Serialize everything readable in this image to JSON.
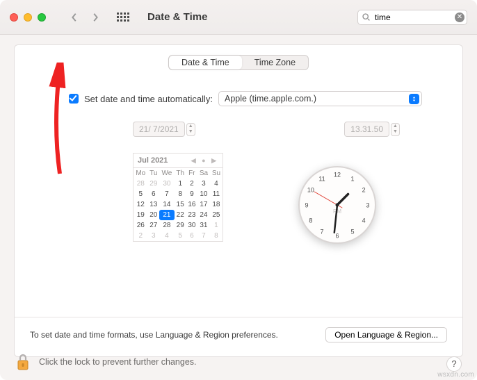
{
  "titlebar": {
    "title": "Date & Time",
    "search_value": "time"
  },
  "tabs": {
    "active": "Date & Time",
    "inactive": "Time Zone"
  },
  "auto": {
    "label": "Set date and time automatically:",
    "server": "Apple (time.apple.com.)"
  },
  "date_field": "21/ 7/2021",
  "time_field": "13.31.50",
  "calendar": {
    "month": "Jul 2021",
    "dow": [
      "Mo",
      "Tu",
      "We",
      "Th",
      "Fr",
      "Sa",
      "Su"
    ],
    "rows": [
      [
        {
          "d": "28",
          "dim": true
        },
        {
          "d": "29",
          "dim": true
        },
        {
          "d": "30",
          "dim": true
        },
        {
          "d": "1"
        },
        {
          "d": "2"
        },
        {
          "d": "3"
        },
        {
          "d": "4"
        }
      ],
      [
        {
          "d": "5"
        },
        {
          "d": "6"
        },
        {
          "d": "7"
        },
        {
          "d": "8"
        },
        {
          "d": "9"
        },
        {
          "d": "10"
        },
        {
          "d": "11"
        }
      ],
      [
        {
          "d": "12"
        },
        {
          "d": "13"
        },
        {
          "d": "14"
        },
        {
          "d": "15"
        },
        {
          "d": "16"
        },
        {
          "d": "17"
        },
        {
          "d": "18"
        }
      ],
      [
        {
          "d": "19"
        },
        {
          "d": "20"
        },
        {
          "d": "21",
          "sel": true
        },
        {
          "d": "22"
        },
        {
          "d": "23"
        },
        {
          "d": "24"
        },
        {
          "d": "25"
        }
      ],
      [
        {
          "d": "26"
        },
        {
          "d": "27"
        },
        {
          "d": "28"
        },
        {
          "d": "29"
        },
        {
          "d": "30"
        },
        {
          "d": "31"
        },
        {
          "d": "1",
          "dim": true
        }
      ],
      [
        {
          "d": "2",
          "dim": true
        },
        {
          "d": "3",
          "dim": true
        },
        {
          "d": "4",
          "dim": true
        },
        {
          "d": "5",
          "dim": true
        },
        {
          "d": "6",
          "dim": true
        },
        {
          "d": "7",
          "dim": true
        },
        {
          "d": "8",
          "dim": true
        }
      ]
    ]
  },
  "clock": {
    "ampm": "PM",
    "hour_angle": 45,
    "minute_angle": 186,
    "second_angle": 300
  },
  "footer": {
    "text": "To set date and time formats, use Language & Region preferences.",
    "button": "Open Language & Region..."
  },
  "lock_text": "Click the lock to prevent further changes.",
  "watermark": "wsxdn.com"
}
